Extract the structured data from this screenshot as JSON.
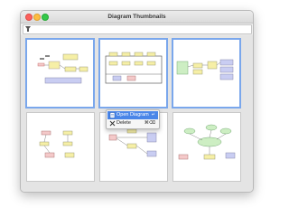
{
  "window": {
    "title": "Diagram Thumbnails"
  },
  "filter": {
    "placeholder": "",
    "value": ""
  },
  "context_menu": {
    "items": [
      {
        "label": "Open Diagram",
        "shortcut": "↵",
        "icon": "document-open-icon"
      },
      {
        "label": "Delete",
        "shortcut": "⌘⌫",
        "icon": "delete-x-icon"
      }
    ]
  },
  "thumbnails": [
    {
      "name": "thumbnail-1",
      "selected": true
    },
    {
      "name": "thumbnail-2",
      "selected": true
    },
    {
      "name": "thumbnail-3",
      "selected": true
    },
    {
      "name": "thumbnail-4",
      "selected": false
    },
    {
      "name": "thumbnail-5",
      "selected": false
    },
    {
      "name": "thumbnail-6",
      "selected": false
    }
  ],
  "colors": {
    "selection_border": "#7aa7ec",
    "menu_highlight": "#4a86e8",
    "node_yellow": "#f6efa6",
    "node_blue": "#c9cdf2",
    "node_red": "#f4c9c9",
    "node_green": "#cdeec3"
  }
}
